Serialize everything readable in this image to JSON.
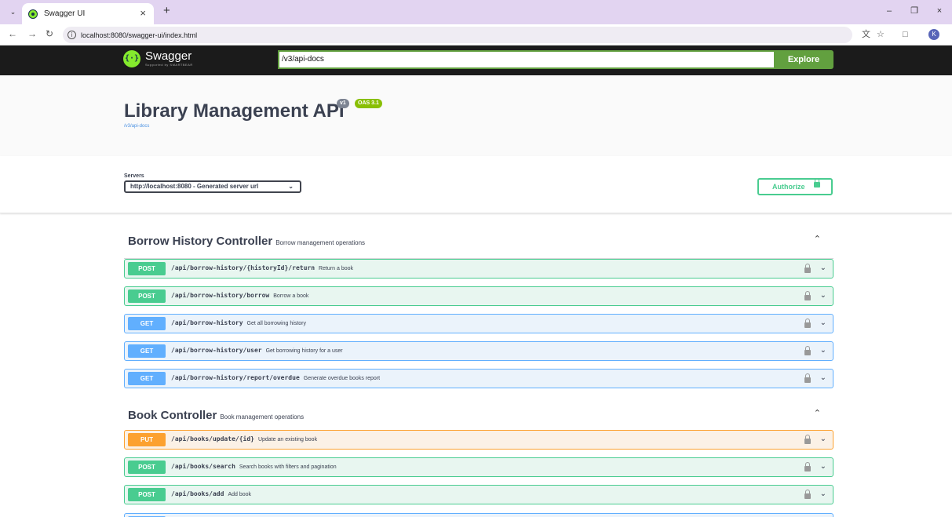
{
  "browser": {
    "tab_title": "Swagger UI",
    "url": "localhost:8080/swagger-ui/index.html",
    "profile_initial": "K"
  },
  "topbar": {
    "logo_text": "Swagger",
    "logo_subtext": "Supported by SMARTBEAR",
    "explore_input": "/v3/api-docs",
    "explore_label": "Explore"
  },
  "info": {
    "title": "Library Management API",
    "version": "v1",
    "oas": "OAS 3.1",
    "url": "/v3/api-docs"
  },
  "servers": {
    "label": "Servers",
    "selected": "http://localhost:8080 - Generated server url",
    "authorize_label": "Authorize"
  },
  "tags": [
    {
      "name": "Borrow History Controller",
      "description": "Borrow management operations",
      "operations": [
        {
          "method": "POST",
          "path": "/api/borrow-history/{historyId}/return",
          "summary": "Return a book"
        },
        {
          "method": "POST",
          "path": "/api/borrow-history/borrow",
          "summary": "Borrow a book"
        },
        {
          "method": "GET",
          "path": "/api/borrow-history",
          "summary": "Get all borrowing history"
        },
        {
          "method": "GET",
          "path": "/api/borrow-history/user",
          "summary": "Get borrowing history for a user"
        },
        {
          "method": "GET",
          "path": "/api/borrow-history/report/overdue",
          "summary": "Generate overdue books report"
        }
      ]
    },
    {
      "name": "Book Controller",
      "description": "Book management operations",
      "operations": [
        {
          "method": "PUT",
          "path": "/api/books/update/{id}",
          "summary": "Update an existing book"
        },
        {
          "method": "POST",
          "path": "/api/books/search",
          "summary": "Search books with filters and pagination"
        },
        {
          "method": "POST",
          "path": "/api/books/add",
          "summary": "Add book"
        }
      ]
    }
  ],
  "colors": {
    "post": "#49cc90",
    "get": "#61affe",
    "put": "#fca130",
    "swagger_green": "#85ea2d",
    "topbar_bg": "#1b1b1b"
  }
}
